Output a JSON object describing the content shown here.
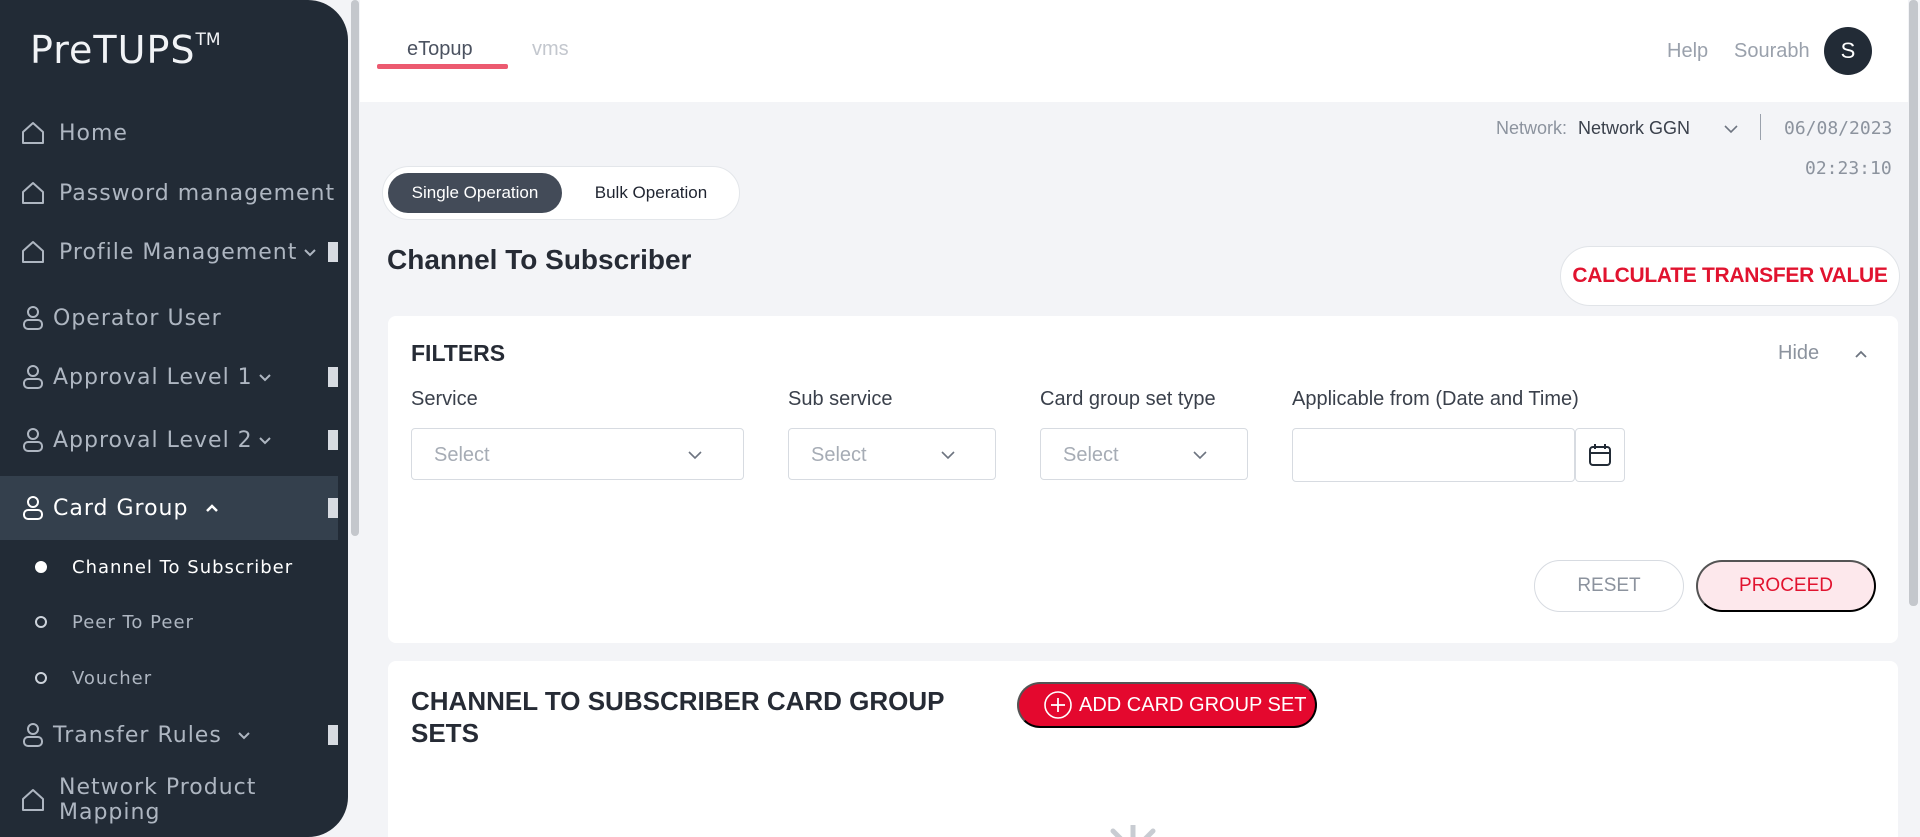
{
  "brand": {
    "name": "PreTUPS",
    "tm": "TM"
  },
  "sidebar": {
    "items": [
      {
        "label": "Home",
        "icon": "home-icon",
        "expandable": false
      },
      {
        "label": "Password management",
        "icon": "home-icon",
        "expandable": false
      },
      {
        "label": "Profile Management",
        "icon": "home-icon",
        "expandable": true
      },
      {
        "label": "Operator User",
        "icon": "user-icon",
        "expandable": false
      },
      {
        "label": "Approval Level 1",
        "icon": "user-icon",
        "expandable": true
      },
      {
        "label": "Approval Level 2",
        "icon": "user-icon",
        "expandable": true
      },
      {
        "label": "Card Group",
        "icon": "user-icon",
        "expandable": true,
        "expanded": true,
        "active": true
      },
      {
        "label": "Transfer Rules",
        "icon": "user-icon",
        "expandable": true
      },
      {
        "label": "Network Product Mapping",
        "icon": "home-icon",
        "expandable": false
      }
    ],
    "sub_items": [
      {
        "label": "Channel To Subscriber",
        "active": true
      },
      {
        "label": "Peer To Peer",
        "active": false
      },
      {
        "label": "Voucher",
        "active": false
      }
    ]
  },
  "header": {
    "tabs": [
      {
        "label": "eTopup",
        "active": true
      },
      {
        "label": "vms",
        "active": false
      }
    ],
    "help_label": "Help",
    "user_name": "Sourabh",
    "avatar_initial": "S"
  },
  "context": {
    "network_label": "Network:",
    "network_value": "Network GGN",
    "date": "06/08/2023",
    "time": "02:23:10"
  },
  "operation_toggle": {
    "options": [
      {
        "label": "Single Operation",
        "active": true
      },
      {
        "label": "Bulk Operation",
        "active": false
      }
    ]
  },
  "page": {
    "title": "Channel To Subscriber",
    "calculate_button": "CALCULATE TRANSFER VALUE"
  },
  "filters": {
    "title": "FILTERS",
    "hide_label": "Hide",
    "service": {
      "label": "Service",
      "placeholder": "Select"
    },
    "sub_service": {
      "label": "Sub service",
      "placeholder": "Select"
    },
    "card_group_set_type": {
      "label": "Card group set type",
      "placeholder": "Select"
    },
    "applicable_from": {
      "label": "Applicable from (Date and Time)",
      "value": ""
    },
    "reset_label": "RESET",
    "proceed_label": "PROCEED"
  },
  "sets": {
    "title": "CHANNEL TO SUBSCRIBER CARD GROUP SETS",
    "add_button": "ADD CARD GROUP SET"
  },
  "colors": {
    "sidebar_bg": "#222b36",
    "sidebar_active": "#34404d",
    "accent_red": "#e4082e",
    "tab_underline": "#ec5a70",
    "proceed_bg": "#fde8ec",
    "page_bg": "#f3f4f7"
  }
}
